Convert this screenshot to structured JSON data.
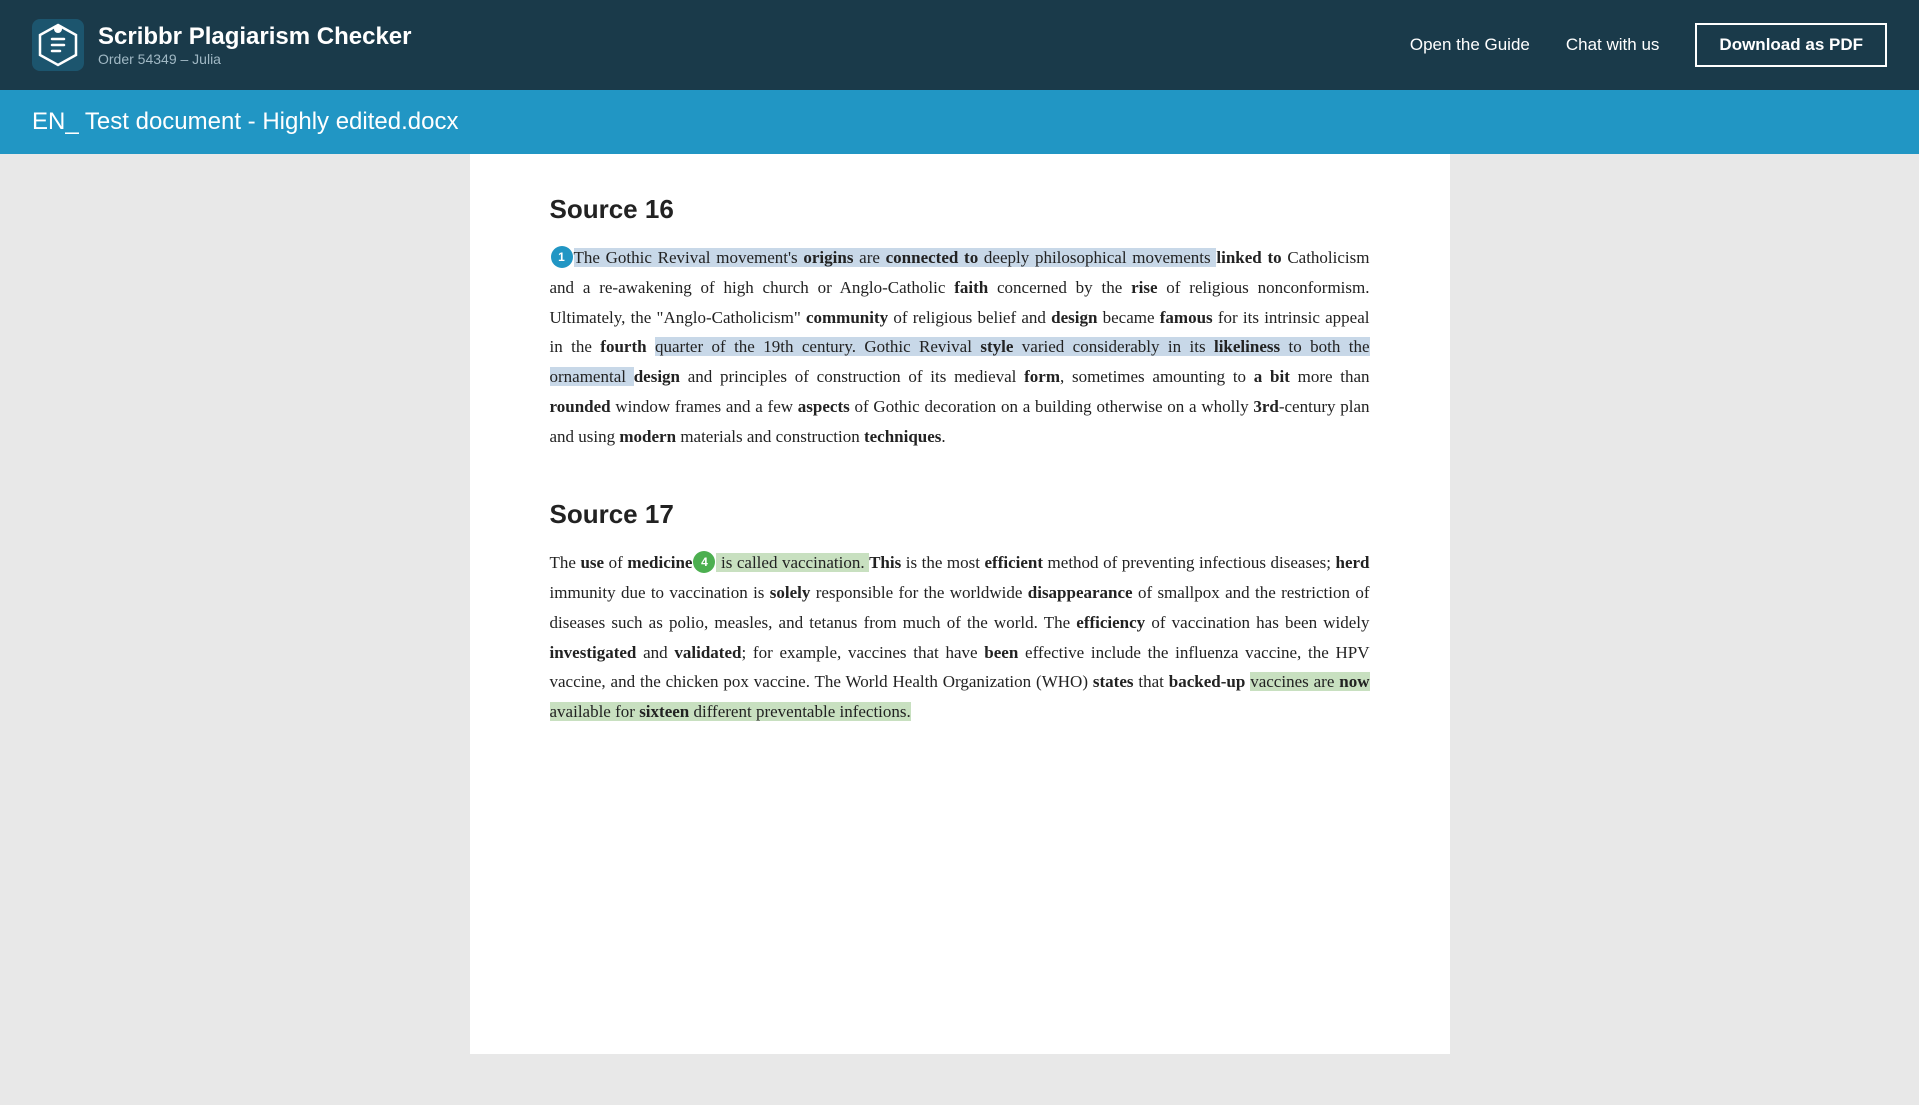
{
  "header": {
    "app_title": "Scribbr Plagiarism Checker",
    "subtitle": "Order 54349 – Julia",
    "nav_links": [
      {
        "id": "open-guide",
        "label": "Open the Guide"
      },
      {
        "id": "chat-with-us",
        "label": "Chat with us"
      }
    ],
    "download_btn": "Download as PDF"
  },
  "doc_title_bar": {
    "title": "EN_ Test document - Highly edited.docx"
  },
  "sources": [
    {
      "id": "source-16",
      "heading": "Source 16",
      "badge": {
        "number": "1",
        "color": "blue"
      },
      "paragraphs": [
        {
          "text_segments": [
            {
              "text": "The Gothic Revival movement's ",
              "style": "hl-blue"
            },
            {
              "text": "origins",
              "style": "hl-blue bld"
            },
            {
              "text": " are ",
              "style": "hl-blue"
            },
            {
              "text": "connected to",
              "style": "hl-blue bld"
            },
            {
              "text": " deeply philosophical movements ",
              "style": "hl-blue"
            },
            {
              "text": "linked to",
              "style": "bld"
            },
            {
              "text": " Catholicism and a re-awakening of high church or Anglo-Catholic ",
              "style": ""
            },
            {
              "text": "faith",
              "style": "bld"
            },
            {
              "text": " concerned by the ",
              "style": ""
            },
            {
              "text": "rise",
              "style": "bld"
            },
            {
              "text": " of religious nonconformism. Ultimately, the \"Anglo-Catholicism\" ",
              "style": ""
            },
            {
              "text": "community",
              "style": "bld"
            },
            {
              "text": " of religious belief and ",
              "style": ""
            },
            {
              "text": "design",
              "style": "bld"
            },
            {
              "text": " became ",
              "style": ""
            },
            {
              "text": "famous",
              "style": "bld"
            },
            {
              "text": " for its intrinsic appeal in the ",
              "style": ""
            },
            {
              "text": "fourth",
              "style": "bld"
            },
            {
              "text": " quarter of the 19th century. Gothic Revival ",
              "style": "hl-blue"
            },
            {
              "text": "style",
              "style": "hl-blue bld"
            },
            {
              "text": " varied considerably in its ",
              "style": "hl-blue"
            },
            {
              "text": "likeliness",
              "style": "hl-blue bld"
            },
            {
              "text": " to both the ornamental ",
              "style": "hl-blue"
            },
            {
              "text": "design",
              "style": "bld"
            },
            {
              "text": " and principles of construction of its medieval ",
              "style": ""
            },
            {
              "text": "form",
              "style": "bld"
            },
            {
              "text": ", sometimes amounting to ",
              "style": ""
            },
            {
              "text": "a bit",
              "style": "bld"
            },
            {
              "text": " more than ",
              "style": ""
            },
            {
              "text": "rounded",
              "style": "bld"
            },
            {
              "text": " window frames and a few ",
              "style": ""
            },
            {
              "text": "aspects",
              "style": "bld"
            },
            {
              "text": " of Gothic decoration on a building otherwise on a wholly ",
              "style": ""
            },
            {
              "text": "3rd",
              "style": "bld"
            },
            {
              "text": "-century plan and using ",
              "style": ""
            },
            {
              "text": "modern",
              "style": "bld"
            },
            {
              "text": " materials and construction ",
              "style": ""
            },
            {
              "text": "techniques",
              "style": "bld"
            },
            {
              "text": ".",
              "style": ""
            }
          ]
        }
      ]
    },
    {
      "id": "source-17",
      "heading": "Source 17",
      "badge": {
        "number": "4",
        "color": "green"
      },
      "paragraphs": [
        {
          "text_segments": [
            {
              "text": "The ",
              "style": ""
            },
            {
              "text": "use",
              "style": "bld"
            },
            {
              "text": " of ",
              "style": ""
            },
            {
              "text": "medicine",
              "style": "bld"
            },
            {
              "text": " is called vaccination. ",
              "style": "hl-green"
            },
            {
              "text": "This",
              "style": "bld"
            },
            {
              "text": " is the most ",
              "style": ""
            },
            {
              "text": "efficient",
              "style": "bld"
            },
            {
              "text": " method of preventing infectious diseases; ",
              "style": ""
            },
            {
              "text": "herd",
              "style": "bld"
            },
            {
              "text": " immunity due to vaccination is ",
              "style": ""
            },
            {
              "text": "solely",
              "style": "bld"
            },
            {
              "text": " responsible for the worldwide ",
              "style": ""
            },
            {
              "text": "disappearance",
              "style": "bld"
            },
            {
              "text": " of smallpox and the restriction of diseases such as polio, measles, and tetanus from much of the world. The ",
              "style": ""
            },
            {
              "text": "efficiency",
              "style": "bld"
            },
            {
              "text": " of vaccination has been widely ",
              "style": ""
            },
            {
              "text": "investigated",
              "style": "bld"
            },
            {
              "text": " and ",
              "style": ""
            },
            {
              "text": "validated",
              "style": "bld"
            },
            {
              "text": "; for example, vaccines that have ",
              "style": ""
            },
            {
              "text": "been",
              "style": "bld"
            },
            {
              "text": " effective include the influenza vaccine, the HPV vaccine, and the chicken pox vaccine. The World Health Organization (WHO) ",
              "style": ""
            },
            {
              "text": "states",
              "style": "bld"
            },
            {
              "text": " that ",
              "style": ""
            },
            {
              "text": "backed-up",
              "style": "bld"
            },
            {
              "text": " vaccines are ",
              "style": "hl-green"
            },
            {
              "text": "now",
              "style": "hl-green bld"
            },
            {
              "text": " available for ",
              "style": "hl-green"
            },
            {
              "text": "sixteen",
              "style": "hl-green bld"
            },
            {
              "text": " different preventable infections.",
              "style": "hl-green"
            }
          ]
        }
      ]
    }
  ]
}
